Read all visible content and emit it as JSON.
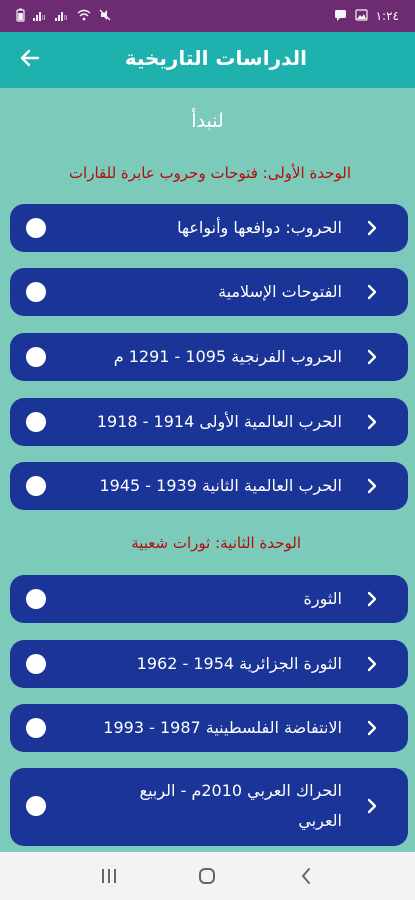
{
  "status_bar": {
    "time": "١:٢٤",
    "left_icons": [
      "battery-icon",
      "signal-icon",
      "signal-icon",
      "wifi-icon",
      "mute-icon"
    ],
    "right_icons": [
      "message-icon",
      "image-icon"
    ]
  },
  "header": {
    "title": "الدراسات التاريخية",
    "back_icon": "arrow-left-icon",
    "color": "#1fb1ad"
  },
  "intro": "لنبدأ",
  "units": [
    {
      "heading": "الوحدة الأولى: فتوحات وحروب عابرة للقارات",
      "items": [
        {
          "label": "الحروب: دوافعها وأنواعها"
        },
        {
          "label": "الفتوحات الإسلامية"
        },
        {
          "label": "الحروب الفرنجية 1095 - 1291 م"
        },
        {
          "label": "الحرب العالمية الأولى 1914 - 1918"
        },
        {
          "label": "الحرب العالمية الثانية 1939 - 1945"
        }
      ]
    },
    {
      "heading": "الوحدة الثانية: ثورات شعبية",
      "items": [
        {
          "label": "الثورة"
        },
        {
          "label": "الثورة الجزائرية 1954 - 1962"
        },
        {
          "label": "الانتفاضة الفلسطينية 1987 - 1993"
        },
        {
          "label": "الحراك العربي 2010م - الربيع العربي"
        }
      ]
    }
  ],
  "nav": {
    "recents_icon": "recents-icon",
    "home_icon": "home-icon",
    "back_icon": "back-chevron-icon"
  },
  "colors": {
    "status_bar": "#6d2b72",
    "background": "#7ccab9",
    "item": "#1a3498",
    "heading": "#b10e0e"
  }
}
